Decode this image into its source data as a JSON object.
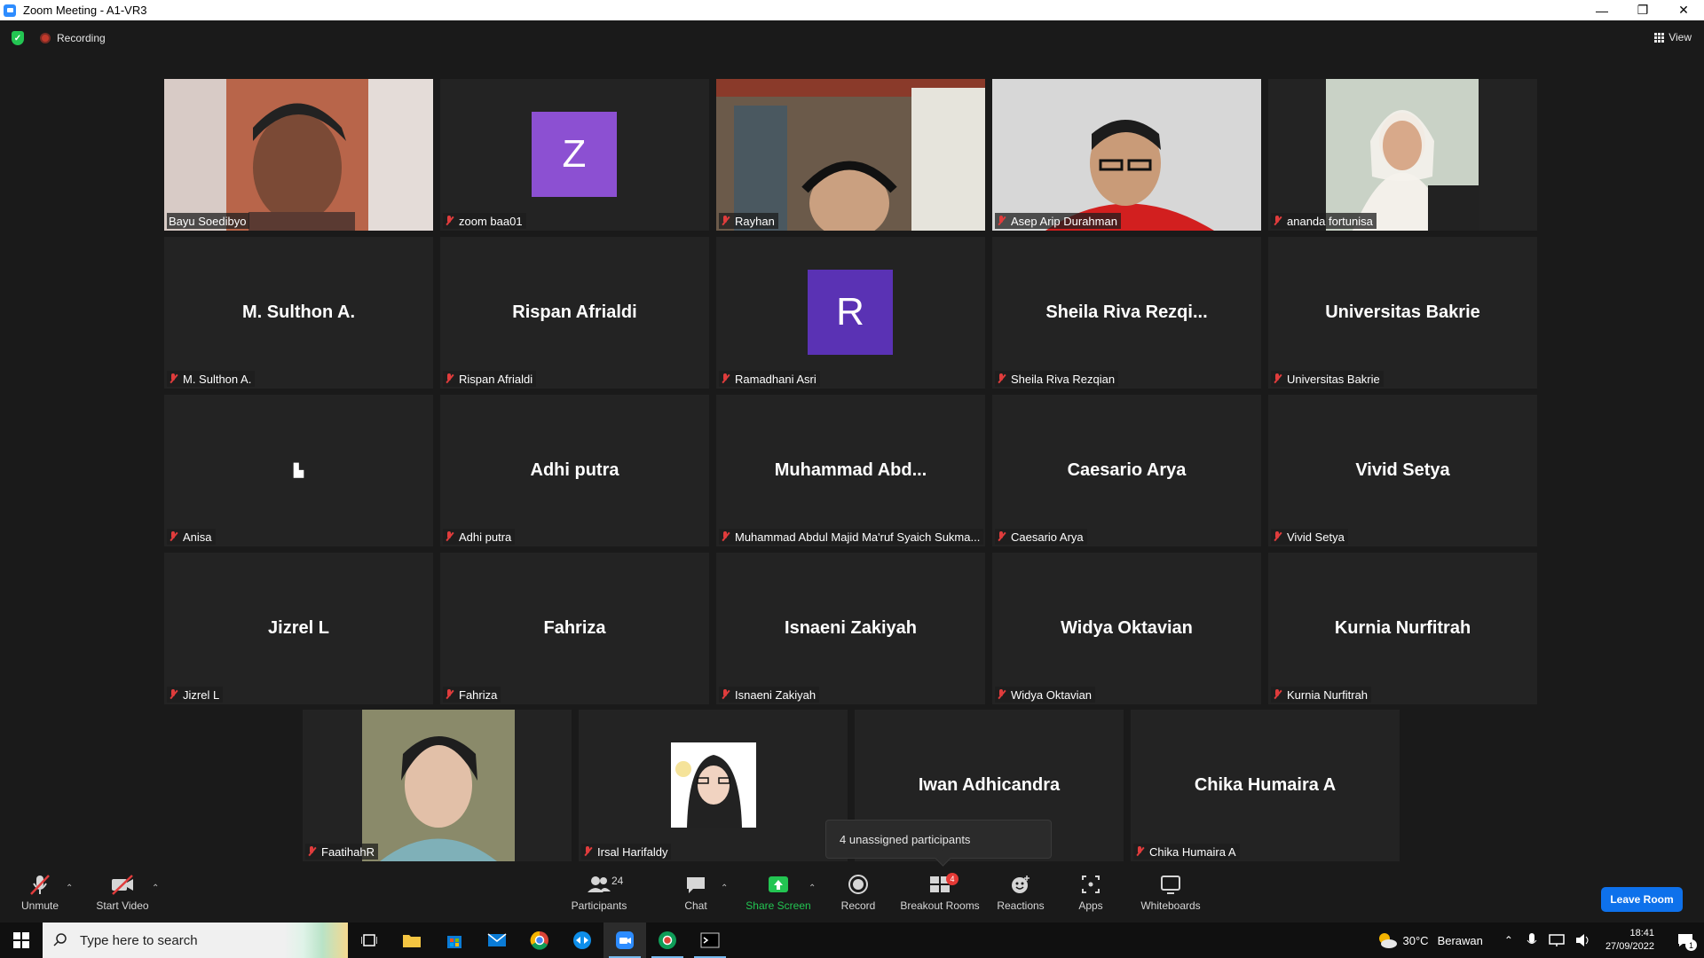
{
  "window": {
    "title": "Zoom Meeting - A1-VR3",
    "controls": [
      "—",
      "❐",
      "✕"
    ]
  },
  "topbar": {
    "recording_label": "Recording",
    "view_label": "View"
  },
  "tiles": [
    {
      "name": "Bayu Soedibyo",
      "display": "",
      "kind": "photo",
      "speaker": true
    },
    {
      "name": "zoom baa01",
      "display": "Z",
      "kind": "letter",
      "color": "#8c50d2"
    },
    {
      "name": "Rayhan",
      "display": "",
      "kind": "photo"
    },
    {
      "name": "Asep Arip Durahman",
      "display": "",
      "kind": "photo"
    },
    {
      "name": "ananda fortunisa",
      "display": "",
      "kind": "photo"
    },
    {
      "name": "M. Sulthon A.",
      "display": "M. Sulthon A.",
      "kind": "text"
    },
    {
      "name": "Rispan Afrialdi",
      "display": "Rispan Afrialdi",
      "kind": "text"
    },
    {
      "name": "Ramadhani Asri",
      "display": "R",
      "kind": "letter",
      "color": "#5a32b4"
    },
    {
      "name": "Sheila Riva Rezqian",
      "display": "Sheila Riva Rezqi...",
      "kind": "text"
    },
    {
      "name": "Universitas Bakrie",
      "display": "Universitas Bakrie",
      "kind": "text"
    },
    {
      "name": "Anisa",
      "display": "▙",
      "kind": "text"
    },
    {
      "name": "Adhi putra",
      "display": "Adhi putra",
      "kind": "text"
    },
    {
      "name": "Muhammad Abdul Majid Ma'ruf Syaich Sukma...",
      "display": "Muhammad Abd...",
      "kind": "text"
    },
    {
      "name": "Caesario Arya",
      "display": "Caesario Arya",
      "kind": "text"
    },
    {
      "name": "Vivid Setya",
      "display": "Vivid Setya",
      "kind": "text"
    },
    {
      "name": "Jizrel L",
      "display": "Jizrel L",
      "kind": "text"
    },
    {
      "name": "Fahriza",
      "display": "Fahriza",
      "kind": "text"
    },
    {
      "name": "Isnaeni Zakiyah",
      "display": "Isnaeni Zakiyah",
      "kind": "text"
    },
    {
      "name": "Widya Oktavian",
      "display": "Widya Oktavian",
      "kind": "text"
    },
    {
      "name": "Kurnia Nurfitrah",
      "display": "Kurnia Nurfitrah",
      "kind": "text"
    },
    {
      "name": "FaatihahR",
      "display": "",
      "kind": "photo"
    },
    {
      "name": "Irsal Harifaldy",
      "display": "",
      "kind": "photo"
    },
    {
      "name": "",
      "display": "Iwan Adhicandra",
      "kind": "text"
    },
    {
      "name": "Chika Humaira A",
      "display": "Chika Humaira A",
      "kind": "text"
    }
  ],
  "tooltip": "4 unassigned participants",
  "toolbar": {
    "unmute": "Unmute",
    "start_video": "Start Video",
    "participants": "Participants",
    "participants_count": "24",
    "chat": "Chat",
    "share_screen": "Share Screen",
    "record": "Record",
    "breakout_rooms": "Breakout Rooms",
    "breakout_badge": "4",
    "reactions": "Reactions",
    "apps": "Apps",
    "whiteboards": "Whiteboards",
    "leave": "Leave Room"
  },
  "taskbar": {
    "search_placeholder": "Type here to search",
    "temperature": "30°C",
    "weather": "Berawan",
    "time": "18:41",
    "date": "27/09/2022",
    "notifications": "1"
  },
  "colors": {
    "accent": "#0e71eb",
    "speaker_border": "#f4f178",
    "share_green": "#23c552",
    "muted_red": "#e03c3c"
  }
}
